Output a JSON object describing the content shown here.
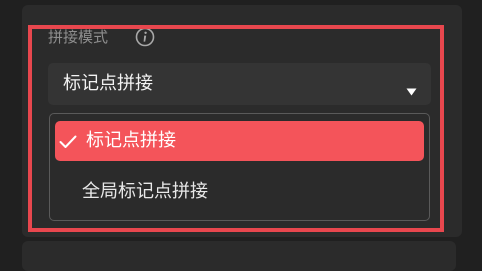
{
  "section": {
    "label": "拼接模式",
    "info_icon": "info-icon"
  },
  "select": {
    "value": "标记点拼接",
    "caret_icon": "caret-down-icon"
  },
  "dropdown": {
    "options": [
      {
        "label": "标记点拼接",
        "selected": true,
        "icon": "check-icon"
      },
      {
        "label": "全局标记点拼接",
        "selected": false
      }
    ]
  },
  "colors": {
    "accent": "#f4545a",
    "highlight_frame": "#e8474e",
    "background": "#202020",
    "panel": "#2b2b2b"
  }
}
